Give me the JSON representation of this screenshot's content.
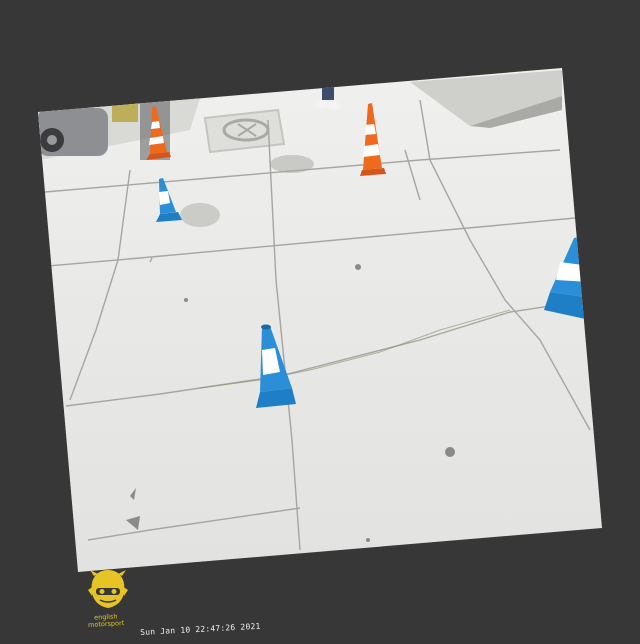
{
  "logo": {
    "line1": "english",
    "line2": "motorsport"
  },
  "overlay": {
    "timestamp": "Sun Jan 10 22:47:26 2021"
  },
  "colors": {
    "background": "#373737",
    "pavement": "#ebebe9",
    "cone_blue": "#2a8fd6",
    "cone_orange": "#ee6a1f",
    "logo_yellow": "#e6c426"
  },
  "icons": {
    "logo": "driver-helmet-logo"
  }
}
